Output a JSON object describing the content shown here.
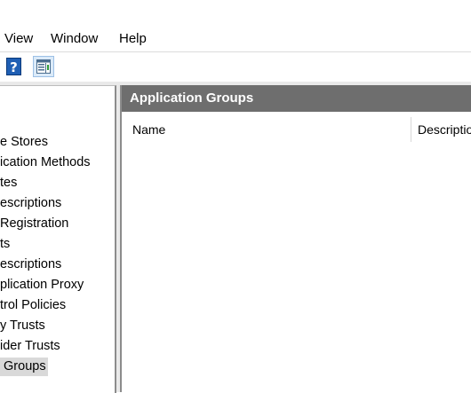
{
  "menu": {
    "items": [
      "View",
      "Window",
      "Help"
    ]
  },
  "toolbar": {
    "help_icon": "help-icon",
    "help_glyph": "?",
    "pane_icon": "show-hide-action-pane-icon"
  },
  "tree": {
    "items": [
      {
        "label": "e Stores",
        "selected": false
      },
      {
        "label": "ication Methods",
        "selected": false
      },
      {
        "label": "tes",
        "selected": false
      },
      {
        "label": "escriptions",
        "selected": false
      },
      {
        "label": "Registration",
        "selected": false
      },
      {
        "label": "ts",
        "selected": false
      },
      {
        "label": "escriptions",
        "selected": false
      },
      {
        "label": "plication Proxy",
        "selected": false
      },
      {
        "label": "trol Policies",
        "selected": false
      },
      {
        "label": "y Trusts",
        "selected": false
      },
      {
        "label": "ider Trusts",
        "selected": false
      },
      {
        "label": " Groups",
        "selected": true
      }
    ]
  },
  "main": {
    "title": "Application Groups",
    "columns": [
      "Name",
      "Descriptio"
    ],
    "rows": []
  },
  "colors": {
    "header_bg": "#6e6e6e",
    "selection_bg": "#d9d9d9",
    "frame_bg": "#e9e9e9"
  }
}
